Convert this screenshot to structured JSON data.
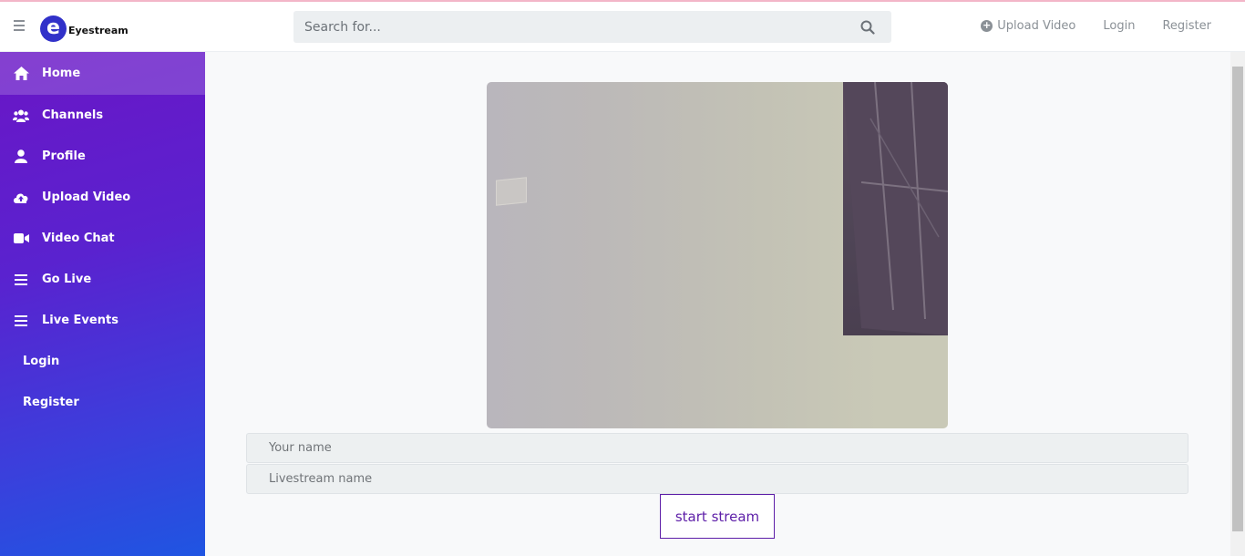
{
  "brand": {
    "logo_letter": "e",
    "name": "Eyestream",
    "logo_color": "#3131c9"
  },
  "header": {
    "search_placeholder": "Search for...",
    "upload_label": "Upload Video",
    "login_label": "Login",
    "register_label": "Register"
  },
  "sidebar": {
    "items": [
      {
        "label": "Home",
        "icon": "home-icon"
      },
      {
        "label": "Channels",
        "icon": "users-icon"
      },
      {
        "label": "Profile",
        "icon": "user-icon"
      },
      {
        "label": "Upload Video",
        "icon": "cloud-upload-icon"
      },
      {
        "label": "Video Chat",
        "icon": "video-camera-icon"
      },
      {
        "label": "Go Live",
        "icon": "bars-icon"
      },
      {
        "label": "Live Events",
        "icon": "bars-icon"
      },
      {
        "label": "Login"
      },
      {
        "label": "Register"
      }
    ],
    "gradient_start": "#6a16c6",
    "gradient_end": "#1f55e2"
  },
  "form": {
    "name_placeholder": "Your name",
    "stream_placeholder": "Livestream name",
    "start_label": "start stream",
    "accent": "#5d1ea8"
  }
}
